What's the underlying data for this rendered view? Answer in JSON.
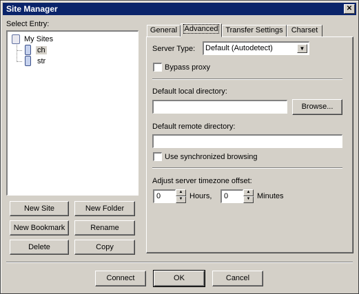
{
  "window": {
    "title": "Site Manager",
    "close_glyph": "✕"
  },
  "left": {
    "select_entry_label": "Select Entry:",
    "tree": {
      "root": "My Sites",
      "items": [
        "ch",
        "str"
      ]
    },
    "buttons": {
      "new_site": "New Site",
      "new_folder": "New Folder",
      "new_bookmark": "New Bookmark",
      "rename": "Rename",
      "delete": "Delete",
      "copy": "Copy"
    }
  },
  "tabs": [
    "General",
    "Advanced",
    "Transfer Settings",
    "Charset"
  ],
  "advanced": {
    "server_type_label": "Server Type:",
    "server_type_value": "Default (Autodetect)",
    "bypass_proxy_label": "Bypass proxy",
    "bypass_proxy_checked": false,
    "default_local_dir_label": "Default local directory:",
    "default_local_dir_value": "",
    "browse_button": "Browse...",
    "default_remote_dir_label": "Default remote directory:",
    "default_remote_dir_value": "",
    "sync_browsing_label": "Use synchronized browsing",
    "sync_browsing_checked": false,
    "timezone_label": "Adjust server timezone offset:",
    "hours_value": "0",
    "hours_label": "Hours,",
    "minutes_value": "0",
    "minutes_label": "Minutes"
  },
  "footer": {
    "connect": "Connect",
    "ok": "OK",
    "cancel": "Cancel"
  },
  "icons": {
    "folder": "folder-icon",
    "site": "site-icon",
    "dropdown": "chevron-down-icon",
    "spin_up": "spin-up-icon",
    "spin_down": "spin-down-icon"
  }
}
